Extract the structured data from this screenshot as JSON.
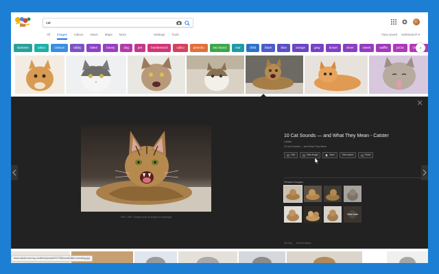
{
  "search": {
    "query": "cat"
  },
  "tabs": [
    {
      "label": "All"
    },
    {
      "label": "Images"
    },
    {
      "label": "Videos"
    },
    {
      "label": "News"
    },
    {
      "label": "Maps"
    },
    {
      "label": "More"
    }
  ],
  "tools": [
    {
      "label": "Settings"
    },
    {
      "label": "Tools"
    }
  ],
  "header_links": [
    {
      "label": "View saved"
    },
    {
      "label": "SafeSearch ▾"
    }
  ],
  "chips": [
    {
      "label": "siamese",
      "color": "#2aa198"
    },
    {
      "label": "calico",
      "color": "#1cb0a8"
    },
    {
      "label": "cartoon",
      "color": "#3b8de0"
    },
    {
      "label": "tabby",
      "color": "#7c53c3"
    },
    {
      "label": "kitten",
      "color": "#8b43c6"
    },
    {
      "label": "bunny",
      "color": "#9a3fc0"
    },
    {
      "label": "dog",
      "color": "#b23ba8"
    },
    {
      "label": "pet",
      "color": "#c4368e"
    },
    {
      "label": "bombernord",
      "color": "#d23576"
    },
    {
      "label": "calico",
      "color": "#d6405e"
    },
    {
      "label": "pinecho",
      "color": "#e0703a"
    },
    {
      "label": "two faced",
      "color": "#3fa64b"
    },
    {
      "label": "mar",
      "color": "#1d9aa6"
    },
    {
      "label": "child",
      "color": "#2f6fc8"
    },
    {
      "label": "black",
      "color": "#4c5bc9"
    },
    {
      "label": "blue",
      "color": "#5a4fc5"
    },
    {
      "label": "orange",
      "color": "#6b45c2"
    },
    {
      "label": "gray",
      "color": "#7542c2"
    },
    {
      "label": "brown",
      "color": "#8140c2"
    },
    {
      "label": "silver",
      "color": "#8a3ec2"
    },
    {
      "label": "sweet",
      "color": "#953cc0"
    },
    {
      "label": "waffle",
      "color": "#a13abe"
    },
    {
      "label": "pizza",
      "color": "#ad38bb"
    },
    {
      "label": "chocolate",
      "color": "#b836b8"
    }
  ],
  "preview": {
    "title": "10 Cat Sounds — and What They Mean - Catster",
    "site": "Catster",
    "subtitle": "10 Cat Sounds — and What They Mean",
    "caption": "599 × 395 · Images may be subject to copyright",
    "actions": [
      {
        "label": "Visit",
        "icon": "globe-icon"
      },
      {
        "label": "View image",
        "icon": "globe-icon"
      },
      {
        "label": "Save",
        "icon": "bookmark-icon"
      },
      {
        "label": "View saved",
        "icon": ""
      },
      {
        "label": "Share",
        "icon": "share-icon"
      }
    ],
    "related_label": "Related images",
    "view_more": "View more",
    "footer_links": [
      {
        "label": "Get help"
      },
      {
        "label": "Send feedback"
      }
    ]
  },
  "status_url": "www.catster.com/wp-content/uploads/2017/08/small-kitten-meowing.jpg"
}
